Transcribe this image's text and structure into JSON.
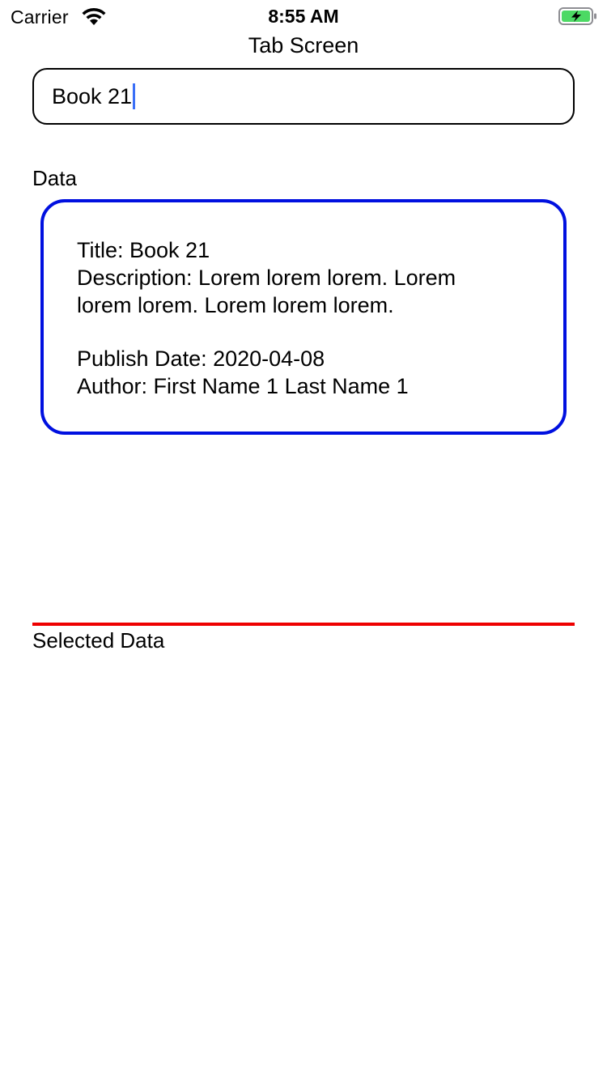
{
  "status_bar": {
    "carrier": "Carrier",
    "time": "8:55 AM",
    "wifi_icon": "wifi-icon",
    "battery_icon": "battery-charging-icon",
    "battery_color": "#4cd964"
  },
  "nav": {
    "title": "Tab Screen"
  },
  "search": {
    "value": "Book 21",
    "caret_color": "#3a6ff7"
  },
  "data_section": {
    "label": "Data",
    "card_border_color": "#0010e0",
    "card": {
      "title": "Title: Book 21",
      "description_line1": "Description: Lorem lorem lorem. Lorem",
      "description_line2": "lorem lorem. Lorem lorem lorem.",
      "publish_date": "Publish Date: 2020-04-08",
      "author": "Author: First Name 1 Last Name 1"
    }
  },
  "selected_section": {
    "label": "Selected Data",
    "divider_color": "#ee0000"
  }
}
